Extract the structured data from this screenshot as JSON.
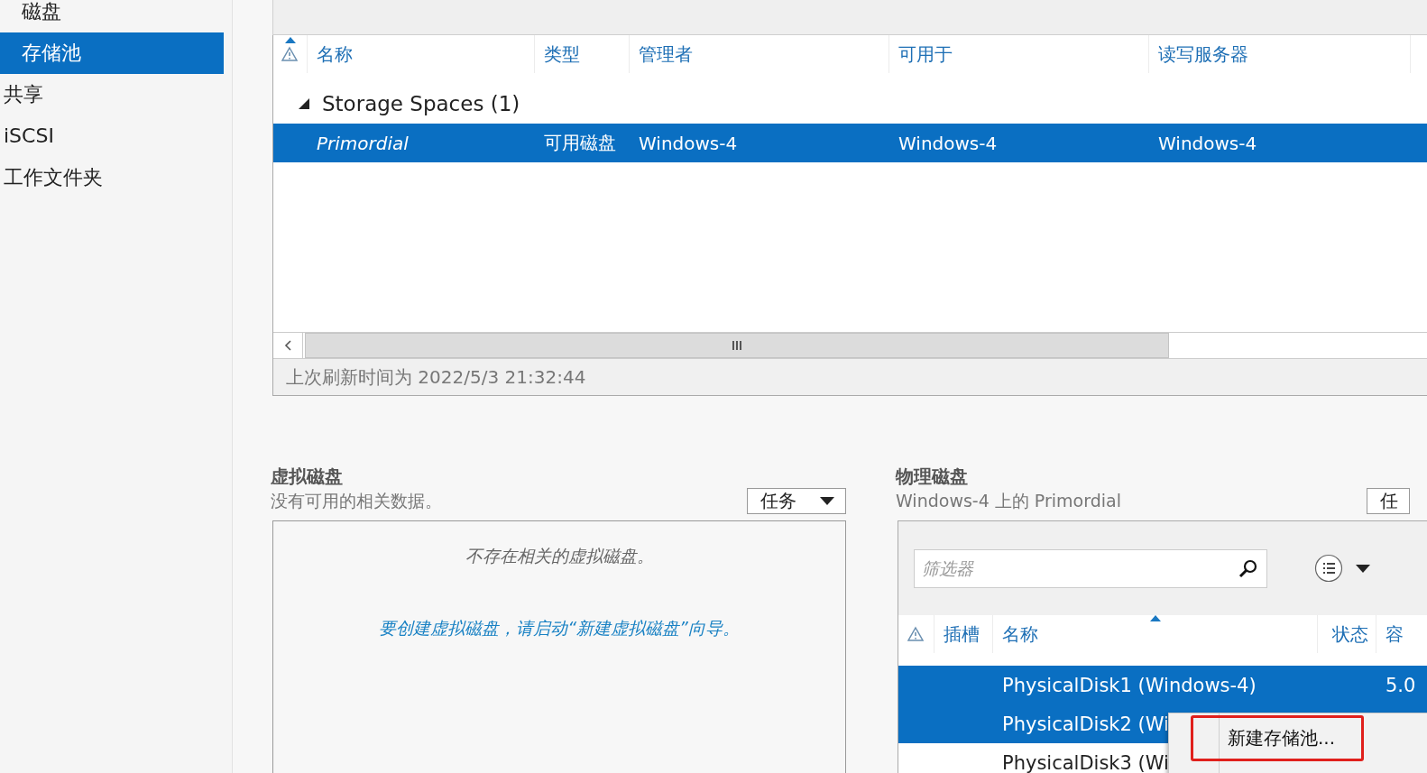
{
  "sidebar": {
    "items": [
      {
        "label": "磁盘",
        "kind": "subitem",
        "selected": false
      },
      {
        "label": "存储池",
        "kind": "subitem",
        "selected": true
      },
      {
        "label": "共享",
        "kind": "item",
        "selected": false
      },
      {
        "label": "iSCSI",
        "kind": "item",
        "selected": false
      },
      {
        "label": "工作文件夹",
        "kind": "item",
        "selected": false
      }
    ]
  },
  "storage_pools": {
    "columns": [
      {
        "kind": "icon",
        "sorted": true
      },
      {
        "kind": "text",
        "label": "名称",
        "sorted": false
      },
      {
        "kind": "text",
        "label": "类型",
        "sorted": false
      },
      {
        "kind": "text",
        "label": "管理者",
        "sorted": false
      },
      {
        "kind": "text",
        "label": "可用于",
        "sorted": false
      },
      {
        "kind": "text",
        "label": "读写服务器",
        "sorted": false
      }
    ],
    "groups": [
      {
        "label": "Storage Spaces (1)",
        "expanded": true,
        "rows": [
          {
            "cells": [
              "Primordial",
              "可用磁盘",
              "Windows-4",
              "Windows-4",
              "Windows-4"
            ],
            "selected": true
          }
        ]
      }
    ],
    "last_refresh": "上次刷新时间为 2022/5/3 21:32:44"
  },
  "virtual_disks": {
    "title": "虚拟磁盘",
    "subtitle": "没有可用的相关数据。",
    "tasks_button": "任务",
    "empty_message": "不存在相关的虚拟磁盘。",
    "hint": "要创建虚拟磁盘，请启动“新建虚拟磁盘”向导。"
  },
  "physical_disks": {
    "title": "物理磁盘",
    "subtitle": "Windows-4 上的 Primordial",
    "tasks_button": "任",
    "filter": {
      "placeholder": "筛选器"
    },
    "columns": [
      {
        "kind": "icon",
        "sorted": false
      },
      {
        "kind": "text",
        "label": "插槽",
        "sorted": false
      },
      {
        "kind": "text",
        "label": "名称",
        "sorted": true
      },
      {
        "kind": "text",
        "label": "状态",
        "sorted": false
      },
      {
        "kind": "text",
        "label": "容",
        "sorted": false
      }
    ],
    "rows": [
      {
        "name": "PhysicalDisk1 (Windows-4)",
        "capacity": "5.0",
        "selected": true
      },
      {
        "name": "PhysicalDisk2 (Wi",
        "selected": true
      },
      {
        "name": "PhysicalDisk3 (Wi",
        "selected": false
      }
    ]
  },
  "context_menu": {
    "items": [
      {
        "label": "新建存储池...",
        "highlighted": true
      }
    ]
  }
}
